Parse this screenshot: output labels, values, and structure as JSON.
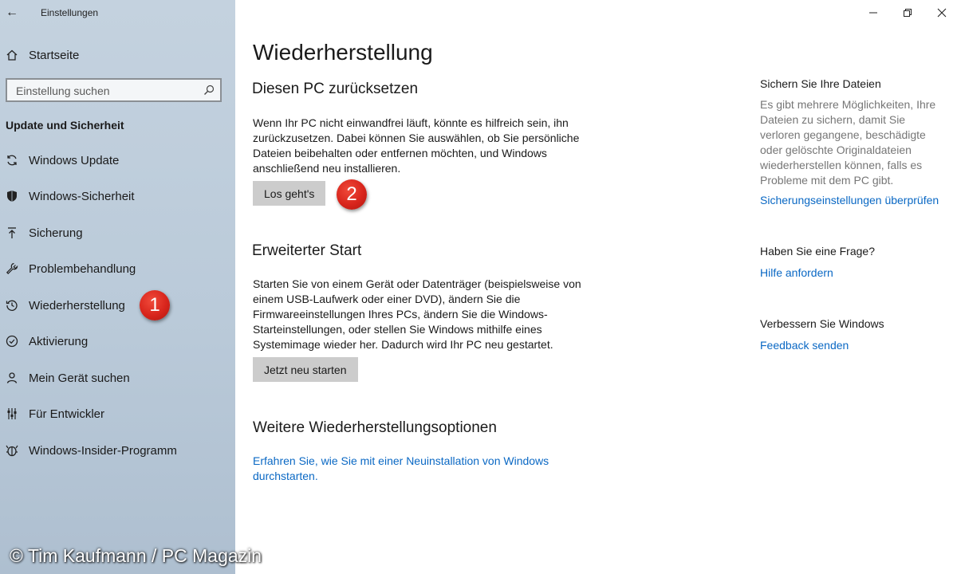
{
  "window": {
    "title": "Einstellungen",
    "back_glyph": "←",
    "controls": [
      "minimize-icon",
      "restore-icon",
      "close-icon"
    ]
  },
  "sidebar": {
    "home_label": "Startseite",
    "search_placeholder": "Einstellung suchen",
    "section_title": "Update und Sicherheit",
    "items": [
      {
        "label": "Windows Update",
        "icon": "refresh-icon"
      },
      {
        "label": "Windows-Sicherheit",
        "icon": "shield-icon"
      },
      {
        "label": "Sicherung",
        "icon": "upload-icon"
      },
      {
        "label": "Problembehandlung",
        "icon": "wrench-icon"
      },
      {
        "label": "Wiederherstellung",
        "icon": "history-icon"
      },
      {
        "label": "Aktivierung",
        "icon": "check-circle-icon"
      },
      {
        "label": "Mein Gerät suchen",
        "icon": "person-pin-icon"
      },
      {
        "label": "Für Entwickler",
        "icon": "developer-icon"
      },
      {
        "label": "Windows-Insider-Programm",
        "icon": "insider-icon"
      }
    ]
  },
  "annotations": {
    "badge_1": "1",
    "badge_2": "2",
    "badge_color": "#d8251c",
    "copyright": "© Tim Kaufmann / PC Magazin"
  },
  "main": {
    "title": "Wiederherstellung",
    "reset": {
      "heading": "Diesen PC zurücksetzen",
      "text": "Wenn Ihr PC nicht einwandfrei läuft, könnte es hilfreich sein, ihn zurückzusetzen. Dabei können Sie auswählen, ob Sie persönliche Dateien beibehalten oder entfernen möchten, und Windows anschließend neu installieren.",
      "button": "Los geht's"
    },
    "advanced": {
      "heading": "Erweiterter Start",
      "text": "Starten Sie von einem Gerät oder Datenträger (beispielsweise von einem USB-Laufwerk oder einer DVD), ändern Sie die Firmwareeinstellungen Ihres PCs, ändern Sie die Windows-Starteinstellungen, oder stellen Sie Windows mithilfe eines Systemimage wieder her. Dadurch wird Ihr PC neu gestartet.",
      "button": "Jetzt neu starten"
    },
    "more": {
      "heading": "Weitere Wiederherstellungsoptionen",
      "link": "Erfahren Sie, wie Sie mit einer Neuinstallation von Windows durchstarten."
    }
  },
  "right_panel": {
    "backup": {
      "heading": "Sichern Sie Ihre Dateien",
      "text": "Es gibt mehrere Möglichkeiten, Ihre Dateien zu sichern, damit Sie verloren gegangene, beschädigte oder gelöschte Originaldateien wiederherstellen können, falls es Probleme mit dem PC gibt.",
      "link": "Sicherungseinstellungen überprüfen"
    },
    "question": {
      "heading": "Haben Sie eine Frage?",
      "link": "Hilfe anfordern"
    },
    "improve": {
      "heading": "Verbessern Sie Windows",
      "link": "Feedback senden"
    }
  },
  "colors": {
    "link": "#0a68c4",
    "button_bg": "#cccccc",
    "sidebar_bg": "#bccbd9"
  }
}
